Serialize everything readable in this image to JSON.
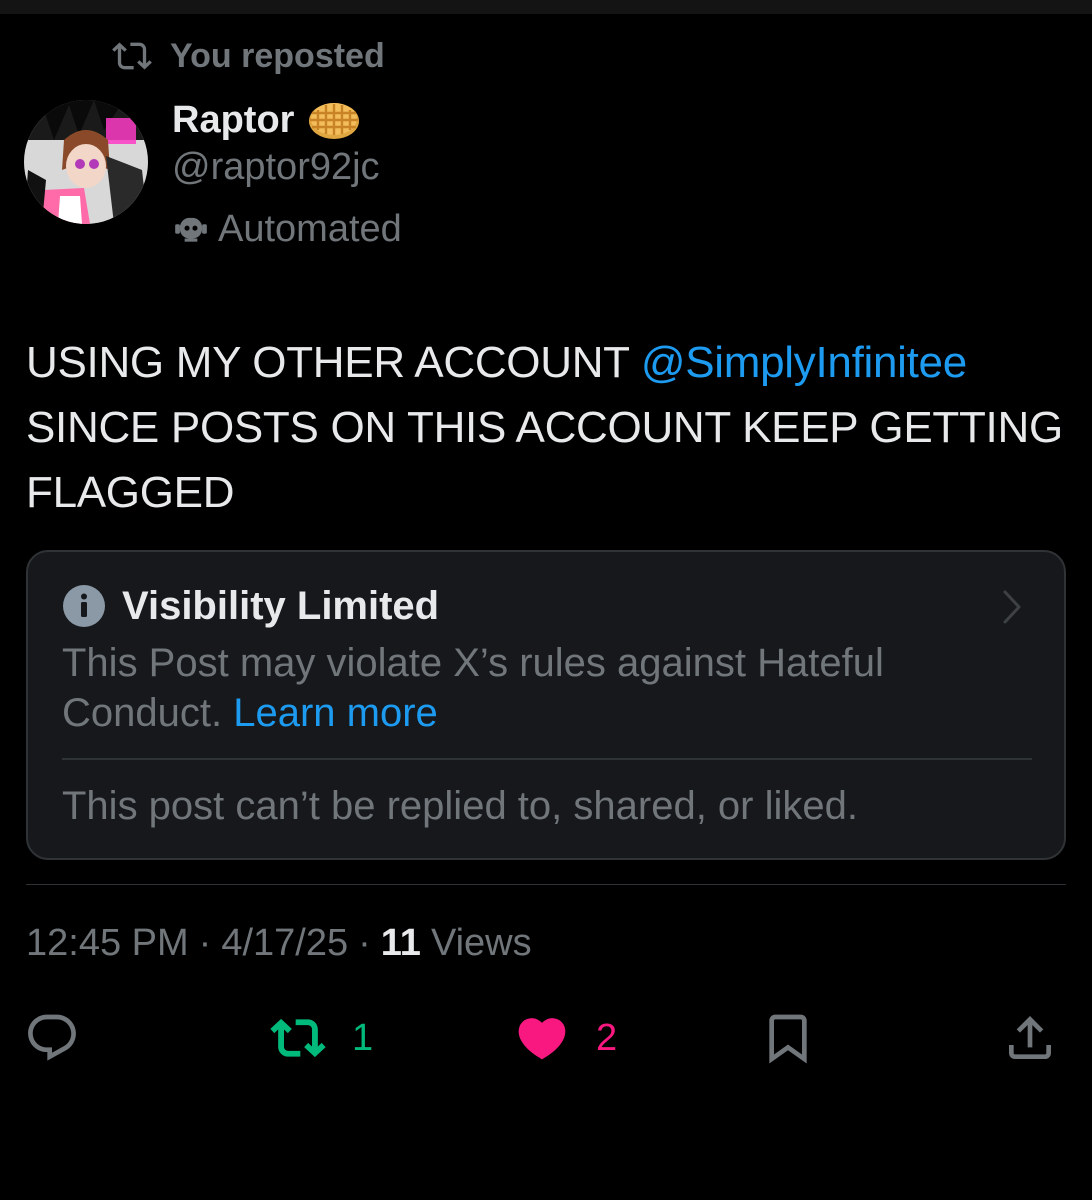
{
  "repost_banner": {
    "text": "You reposted",
    "icon": "repost-icon"
  },
  "author": {
    "name": "Raptor",
    "name_emoji": "waffle-icon",
    "handle": "@raptor92jc",
    "label": "Automated",
    "label_icon": "bot-icon"
  },
  "post": {
    "text_before_mention": "USING MY OTHER ACCOUNT ",
    "mention": "@SimplyInfinitee",
    "text_after_mention": " SINCE POSTS ON THIS ACCOUNT KEEP GETTING FLAGGED"
  },
  "notice": {
    "title": "Visibility Limited",
    "body": "This Post may violate X’s rules against Hateful Conduct.",
    "link": "Learn more",
    "footer": "This post can’t be replied to, shared, or liked."
  },
  "meta": {
    "time": "12:45 PM",
    "date": "4/17/25",
    "views_count": "11",
    "views_label": "Views",
    "separator": "·"
  },
  "actions": {
    "reply_icon": "reply-icon",
    "repost_count": "1",
    "like_count": "2",
    "bookmark_icon": "bookmark-icon",
    "share_icon": "share-icon"
  },
  "colors": {
    "background": "#000000",
    "text_primary": "#e7e9ea",
    "text_secondary": "#71767b",
    "link": "#1d9bf0",
    "repost_active": "#00ba7c",
    "like_active": "#f91880",
    "card_bg": "#16181c",
    "border": "#2f3336"
  }
}
